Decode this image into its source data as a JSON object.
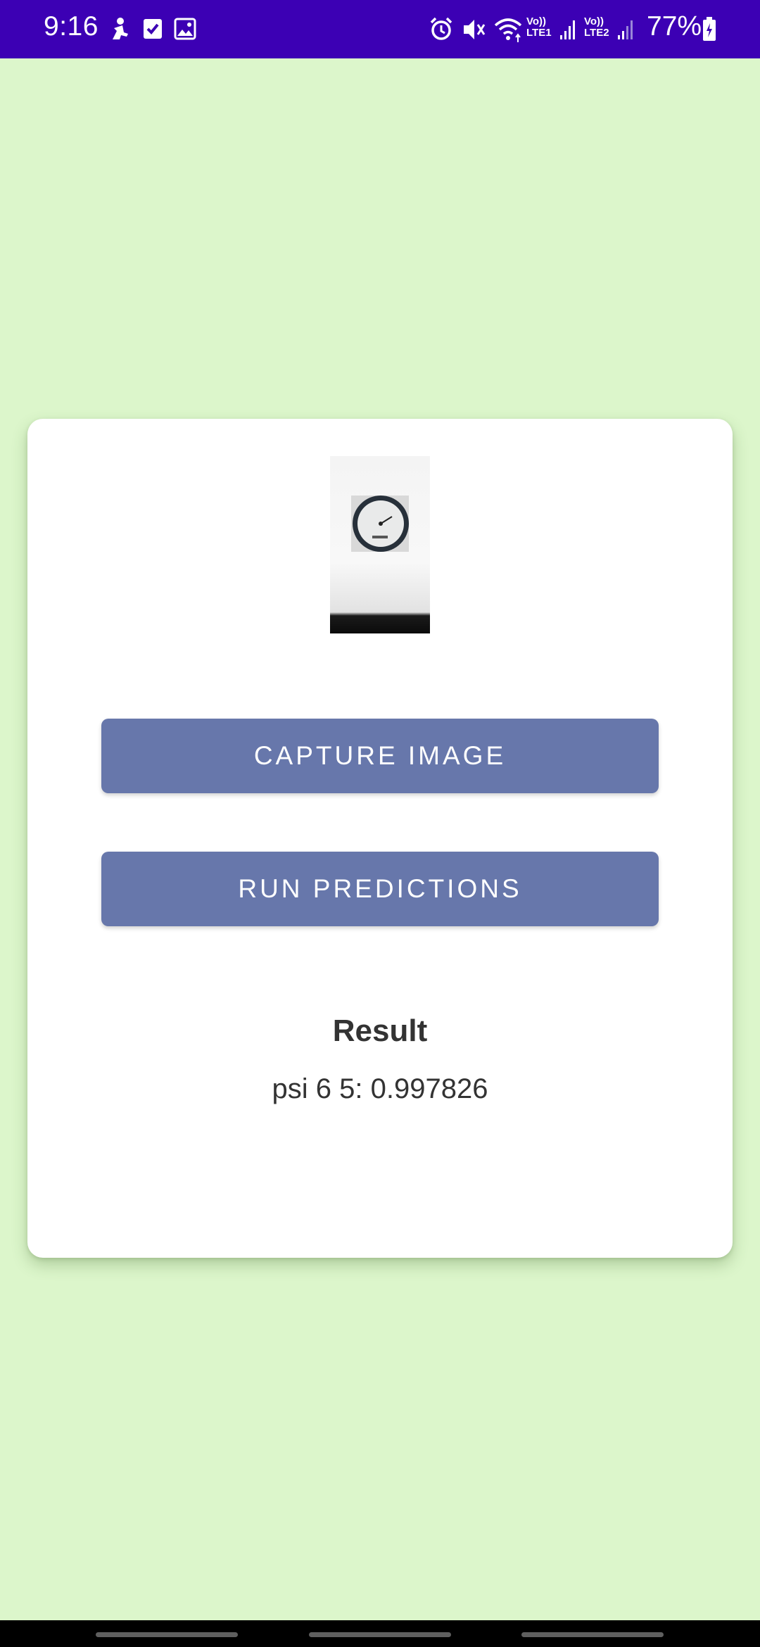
{
  "status_bar": {
    "time": "9:16",
    "battery": "77%",
    "sim1_label": "Vo))\nLTE1",
    "sim2_label": "Vo))\nLTE2",
    "icons": [
      "accessibility-icon",
      "task-check-icon",
      "gallery-icon",
      "alarm-icon",
      "mute-icon",
      "wifi-icon",
      "signal-icon",
      "signal-icon",
      "battery-charging-icon"
    ]
  },
  "main": {
    "image_alt": "captured gauge photo",
    "capture_button_label": "CAPTURE IMAGE",
    "predict_button_label": "RUN PREDICTIONS",
    "result_title": "Result",
    "result_value": "psi 6 5: 0.997826"
  },
  "colors": {
    "status_bar": "#3c00b4",
    "background": "#dcf6cb",
    "button": "#6777ab",
    "card": "#ffffff"
  }
}
